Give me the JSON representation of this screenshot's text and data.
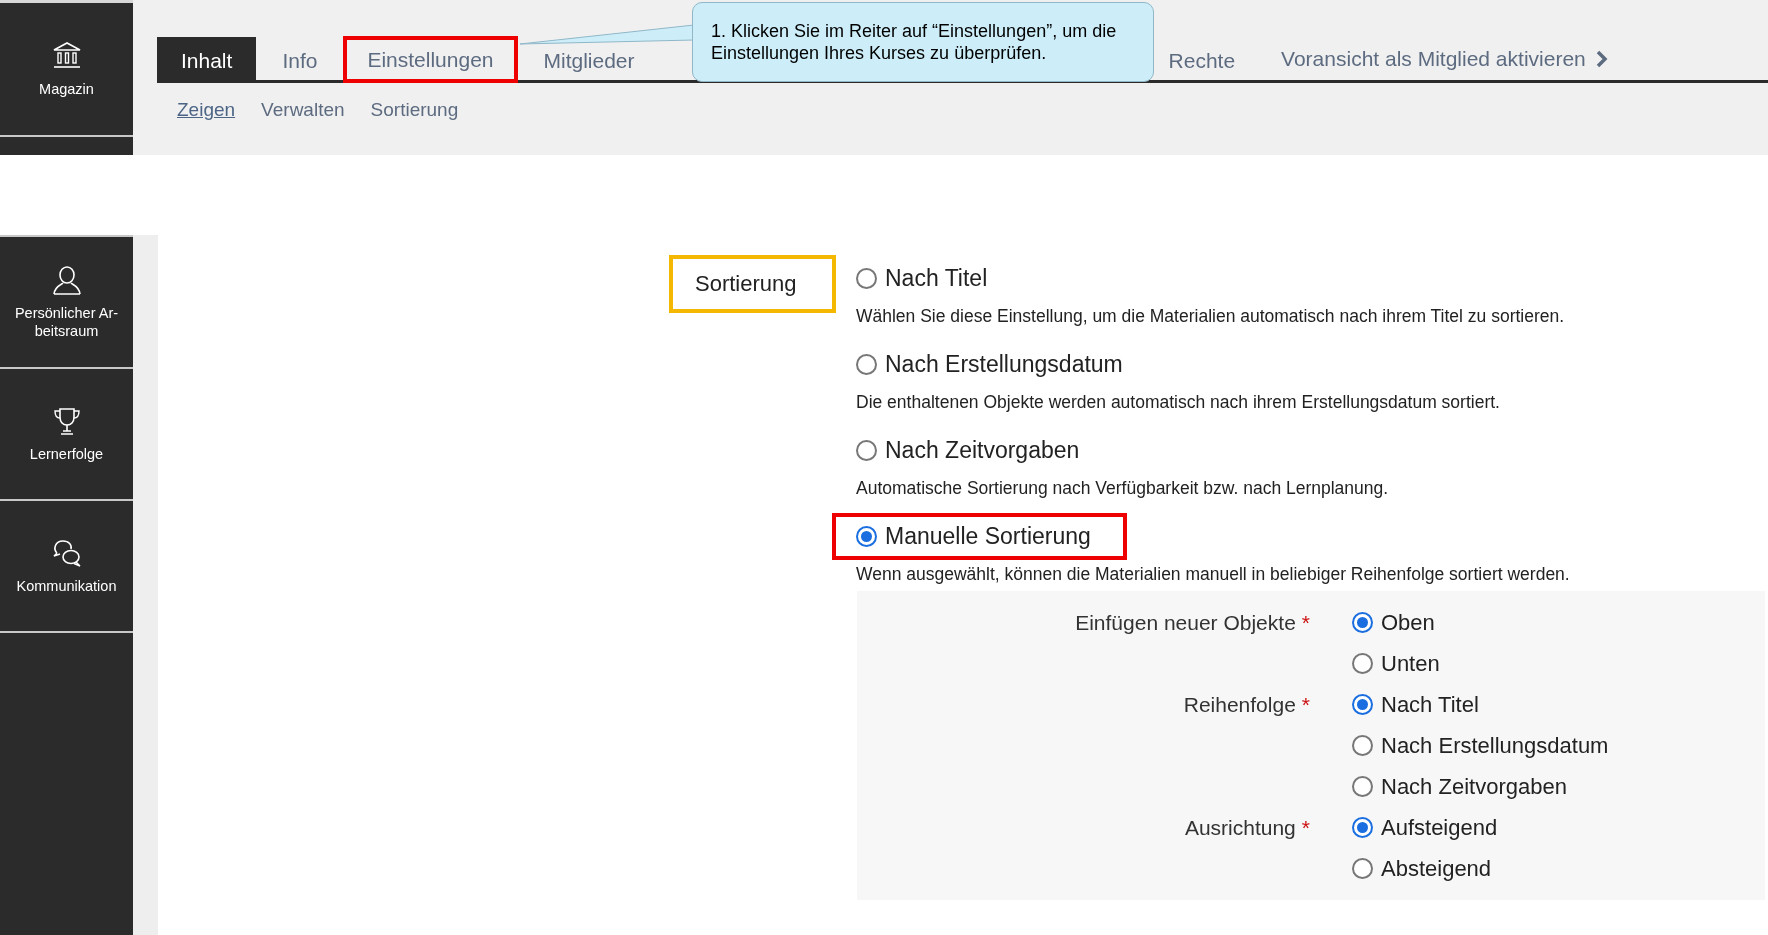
{
  "sidebar_top": {
    "label": "Magazin",
    "kind": "building"
  },
  "tabs": [
    {
      "label": "Inhalt",
      "selected": true,
      "highlighted": false
    },
    {
      "label": "Info",
      "selected": false,
      "highlighted": false
    },
    {
      "label": "Einstellungen",
      "selected": false,
      "highlighted": true
    },
    {
      "label": "Mitglieder",
      "selected": false,
      "highlighted": false
    },
    {
      "label": "Rechte",
      "selected": false,
      "highlighted": false
    }
  ],
  "preview_link": {
    "label": "Voransicht als Mitglied aktivieren"
  },
  "subtabs": [
    {
      "label": "Zeigen",
      "selected": true
    },
    {
      "label": "Verwalten",
      "selected": false
    },
    {
      "label": "Sortierung",
      "selected": false
    }
  ],
  "callout": {
    "text": "1. Klicken Sie im Reiter auf “Einstellungen”, um die Einstellungen Ihres Kurses zu überprüfen."
  },
  "sidebar": [
    {
      "label": "Persönlicher Ar-beitsraum",
      "kind": "person"
    },
    {
      "label": "Lernerfolge",
      "kind": "trophy"
    },
    {
      "label": "Kommunikation",
      "kind": "chat"
    }
  ],
  "sorting": {
    "label": "Sortierung",
    "highlighted": true,
    "options": [
      {
        "label": "Nach Titel",
        "description": "Wählen Sie diese Einstellung, um die Materialien automatisch nach ihrem Titel zu sortieren.",
        "selected": false,
        "highlighted": false
      },
      {
        "label": "Nach Erstellungsdatum",
        "description": "Die enthaltenen Objekte werden automatisch nach ihrem Erstellungsdatum sortiert.",
        "selected": false,
        "highlighted": false
      },
      {
        "label": "Nach Zeitvorgaben",
        "description": "Automatische Sortierung nach Verfügbarkeit bzw. nach Lernplanung.",
        "selected": false,
        "highlighted": false
      },
      {
        "label": "Manuelle Sortierung",
        "description": "Wenn ausgewählt, können die Materialien manuell in beliebiger Reihenfolge sortiert werden.",
        "selected": true,
        "highlighted": true
      }
    ],
    "manual_settings": [
      {
        "label": "Einfügen neuer Objekte",
        "required": "*",
        "options": [
          {
            "label": "Oben",
            "selected": true
          },
          {
            "label": "Unten",
            "selected": false
          }
        ]
      },
      {
        "label": "Reihenfolge",
        "required": "*",
        "options": [
          {
            "label": "Nach Titel",
            "selected": true
          },
          {
            "label": "Nach Erstellungsdatum",
            "selected": false
          },
          {
            "label": "Nach Zeitvorgaben",
            "selected": false
          }
        ]
      },
      {
        "label": "Ausrichtung",
        "required": "*",
        "options": [
          {
            "label": "Aufsteigend",
            "selected": true
          },
          {
            "label": "Absteigend",
            "selected": false
          }
        ]
      }
    ]
  }
}
